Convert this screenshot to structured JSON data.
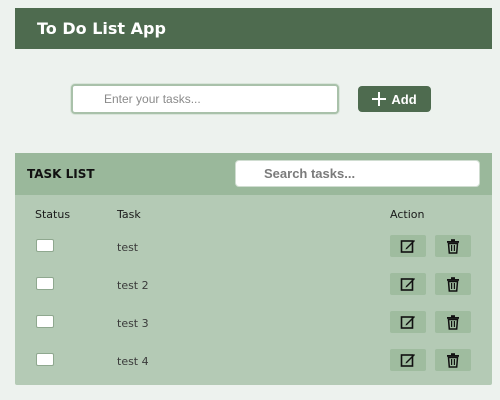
{
  "app": {
    "title": "To Do List App"
  },
  "add_form": {
    "placeholder": "Enter your tasks...",
    "button_label": "Add",
    "button_icon": "plus-icon"
  },
  "task_panel": {
    "title": "TASK LIST",
    "search_placeholder": "Search tasks...",
    "columns": {
      "status": "Status",
      "task": "Task",
      "action": "Action"
    },
    "tasks": [
      {
        "label": "test",
        "done": false
      },
      {
        "label": "test 2",
        "done": false
      },
      {
        "label": "test 3",
        "done": false
      },
      {
        "label": "test 4",
        "done": false
      }
    ],
    "action_icons": [
      "edit-icon",
      "trash-icon"
    ]
  },
  "colors": {
    "primary": "#4e6b4f",
    "panel": "#b4cab5",
    "panel_header": "#9ab89b",
    "action_button": "#9fbc9f",
    "page_bg": "#edf2ee"
  }
}
